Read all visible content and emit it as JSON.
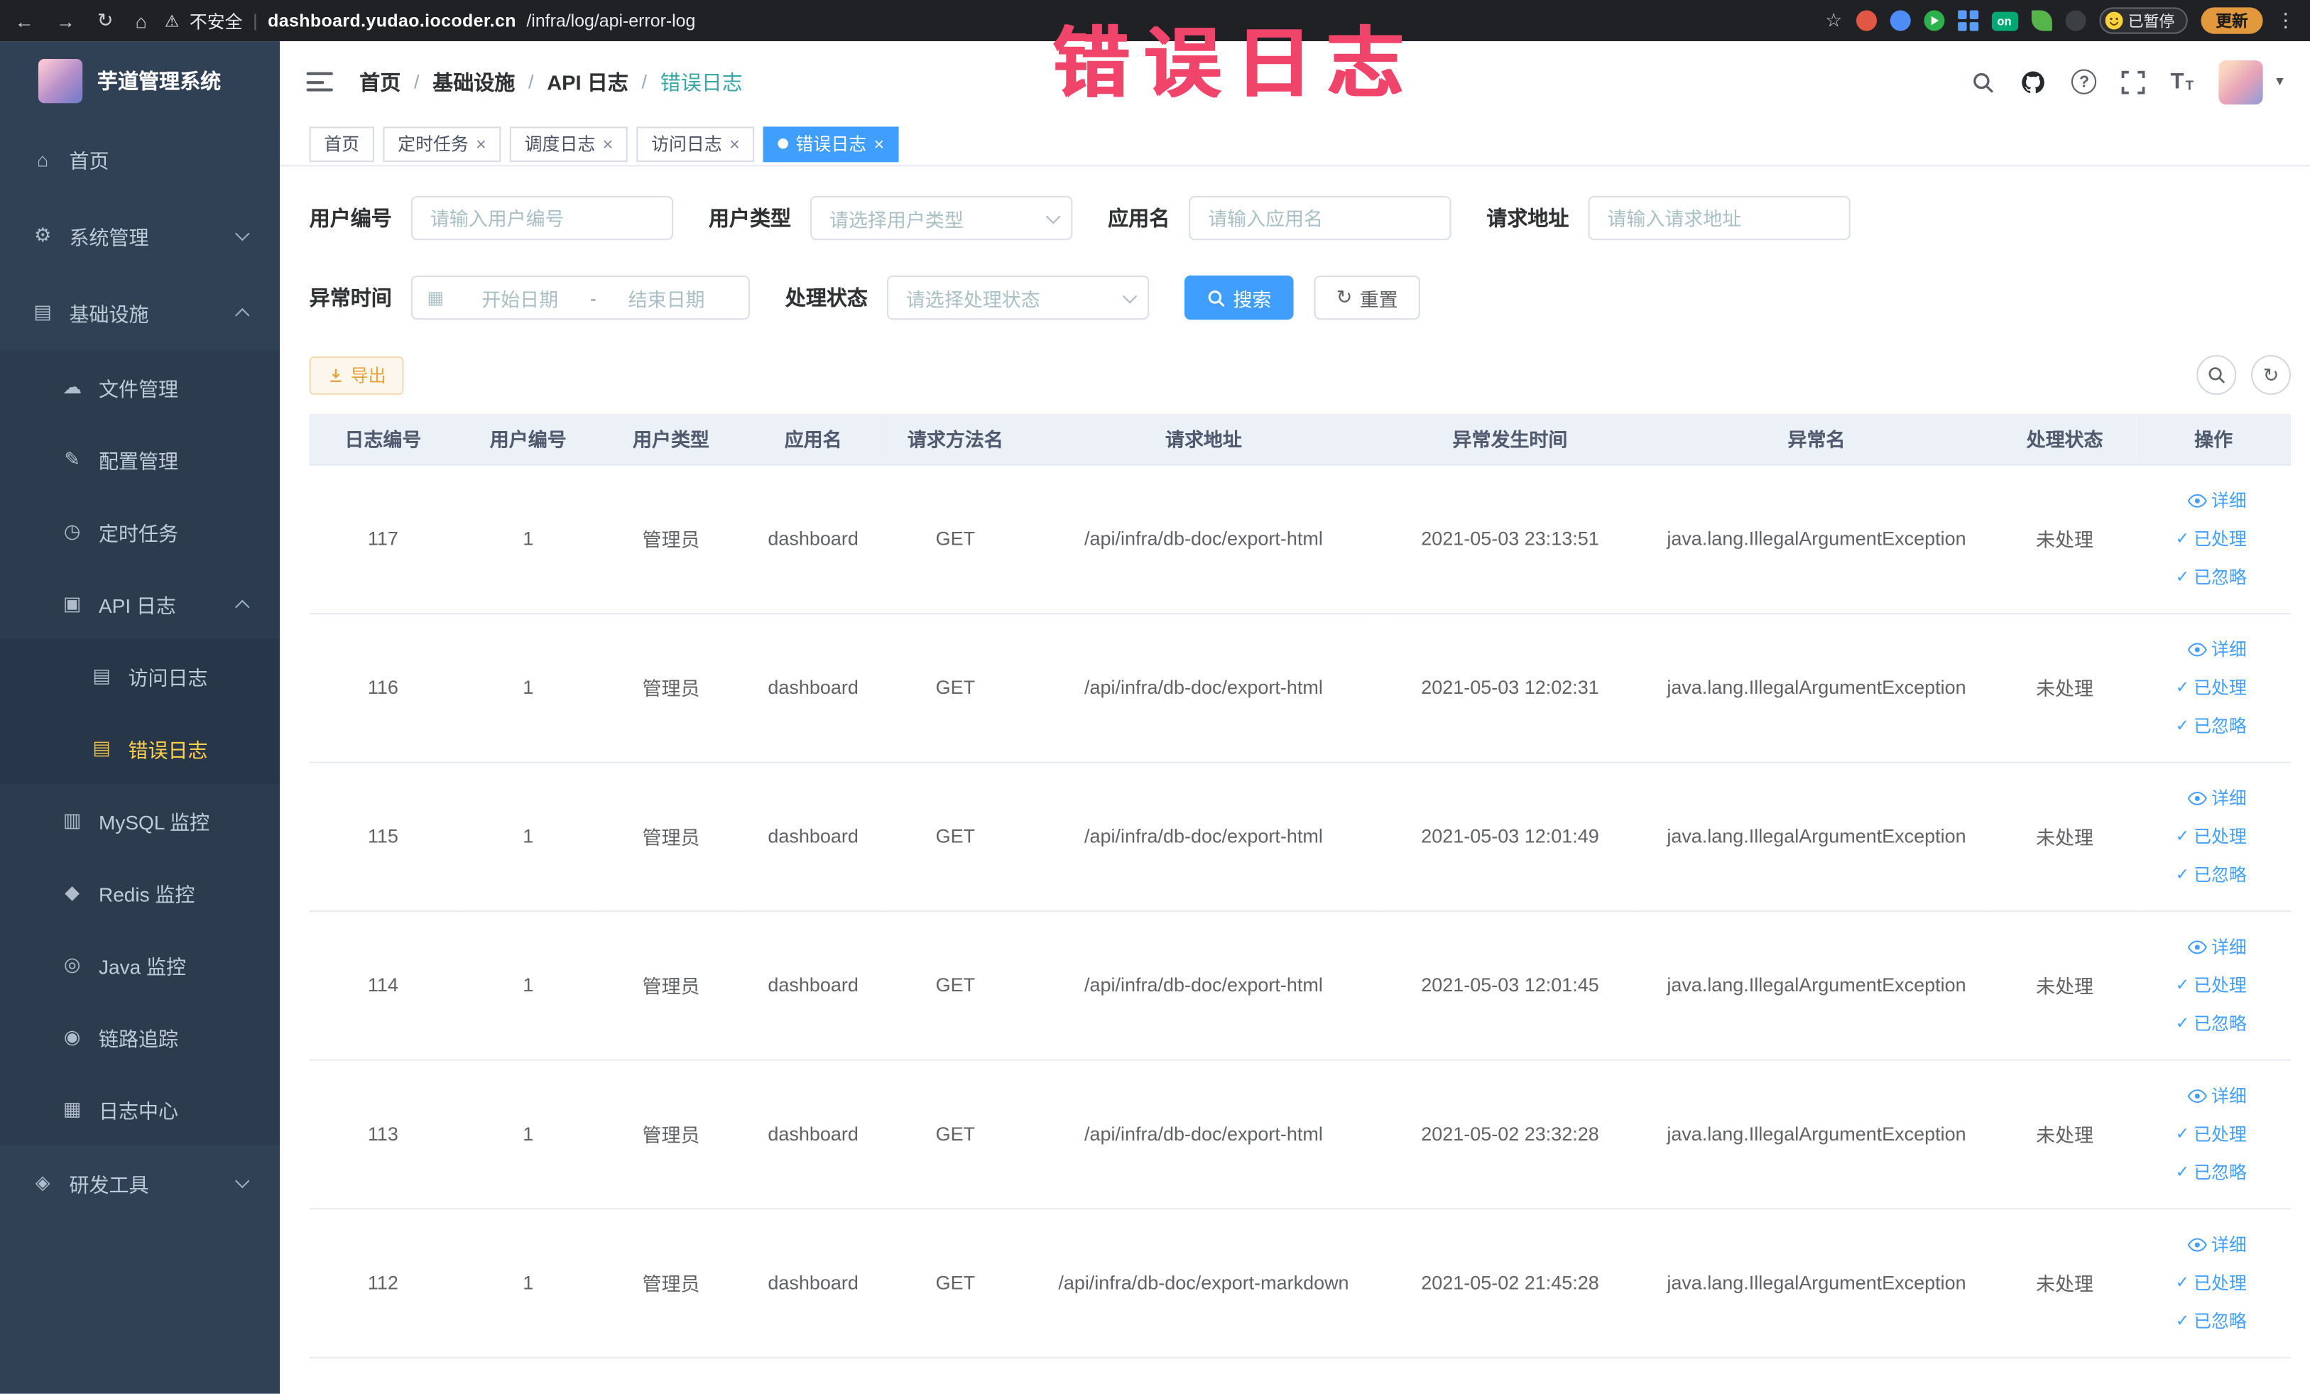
{
  "browser": {
    "security_label": "不安全",
    "url_separator": "|",
    "url_domain": "dashboard.yudao.iocoder.cn",
    "url_path": "/infra/log/api-error-log",
    "extension_on_badge": "on",
    "paused_badge": "已暂停",
    "update_button": "更新"
  },
  "annotation": {
    "text": "错误日志"
  },
  "sidebar": {
    "logo_title": "芋道管理系统",
    "items": [
      {
        "label": "首页"
      },
      {
        "label": "系统管理"
      },
      {
        "label": "基础设施"
      },
      {
        "label": "文件管理"
      },
      {
        "label": "配置管理"
      },
      {
        "label": "定时任务"
      },
      {
        "label": "API 日志"
      },
      {
        "label": "访问日志"
      },
      {
        "label": "错误日志"
      },
      {
        "label": "MySQL 监控"
      },
      {
        "label": "Redis 监控"
      },
      {
        "label": "Java 监控"
      },
      {
        "label": "链路追踪"
      },
      {
        "label": "日志中心"
      },
      {
        "label": "研发工具"
      }
    ]
  },
  "breadcrumb": {
    "separator": "/",
    "items": [
      "首页",
      "基础设施",
      "API 日志",
      "错误日志"
    ]
  },
  "tabs": [
    {
      "label": "首页"
    },
    {
      "label": "定时任务"
    },
    {
      "label": "调度日志"
    },
    {
      "label": "访问日志"
    },
    {
      "label": "错误日志"
    }
  ],
  "filters": {
    "user_id_label": "用户编号",
    "user_id_placeholder": "请输入用户编号",
    "user_type_label": "用户类型",
    "user_type_placeholder": "请选择用户类型",
    "app_name_label": "应用名",
    "app_name_placeholder": "请输入应用名",
    "request_url_label": "请求地址",
    "request_url_placeholder": "请输入请求地址",
    "exception_time_label": "异常时间",
    "date_start_placeholder": "开始日期",
    "date_separator": "-",
    "date_end_placeholder": "结束日期",
    "process_status_label": "处理状态",
    "process_status_placeholder": "请选择处理状态",
    "search_button": "搜索",
    "reset_button": "重置"
  },
  "toolbar": {
    "export_button": "导出"
  },
  "table": {
    "columns": [
      "日志编号",
      "用户编号",
      "用户类型",
      "应用名",
      "请求方法名",
      "请求地址",
      "异常发生时间",
      "异常名",
      "处理状态",
      "操作"
    ],
    "actions": [
      "详细",
      "已处理",
      "已忽略"
    ],
    "rows": [
      {
        "id": "117",
        "user_id": "1",
        "user_type": "管理员",
        "app": "dashboard",
        "method": "GET",
        "url": "/api/infra/db-doc/export-html",
        "time": "2021-05-03 23:13:51",
        "exception": "java.lang.IllegalArgumentException",
        "status": "未处理"
      },
      {
        "id": "116",
        "user_id": "1",
        "user_type": "管理员",
        "app": "dashboard",
        "method": "GET",
        "url": "/api/infra/db-doc/export-html",
        "time": "2021-05-03 12:02:31",
        "exception": "java.lang.IllegalArgumentException",
        "status": "未处理"
      },
      {
        "id": "115",
        "user_id": "1",
        "user_type": "管理员",
        "app": "dashboard",
        "method": "GET",
        "url": "/api/infra/db-doc/export-html",
        "time": "2021-05-03 12:01:49",
        "exception": "java.lang.IllegalArgumentException",
        "status": "未处理"
      },
      {
        "id": "114",
        "user_id": "1",
        "user_type": "管理员",
        "app": "dashboard",
        "method": "GET",
        "url": "/api/infra/db-doc/export-html",
        "time": "2021-05-03 12:01:45",
        "exception": "java.lang.IllegalArgumentException",
        "status": "未处理"
      },
      {
        "id": "113",
        "user_id": "1",
        "user_type": "管理员",
        "app": "dashboard",
        "method": "GET",
        "url": "/api/infra/db-doc/export-html",
        "time": "2021-05-02 23:32:28",
        "exception": "java.lang.IllegalArgumentException",
        "status": "未处理"
      },
      {
        "id": "112",
        "user_id": "1",
        "user_type": "管理员",
        "app": "dashboard",
        "method": "GET",
        "url": "/api/infra/db-doc/export-markdown",
        "time": "2021-05-02 21:45:28",
        "exception": "java.lang.IllegalArgumentException",
        "status": "未处理"
      }
    ]
  },
  "icons": {
    "back": "←",
    "forward": "→",
    "reload": "↻",
    "browser_home": "⌂",
    "warning": "⚠",
    "star": "☆",
    "menu_dots": "⋮",
    "home": "⌂",
    "gear": "⚙",
    "infra": "▤",
    "file": "☁",
    "config": "✎",
    "timer": "◷",
    "api_log": "▣",
    "doc": "▤",
    "mysql": "▥",
    "redis": "◆",
    "java": "◎",
    "trace": "◉",
    "log_center": "▦",
    "tools": "◈",
    "question": "?",
    "font_size_large": "T",
    "font_size_small": "T",
    "caret_down": "▾",
    "calendar": "▦",
    "refresh": "↻",
    "check": "✓",
    "close": "×"
  }
}
